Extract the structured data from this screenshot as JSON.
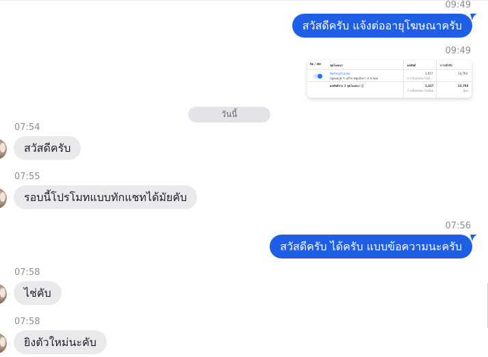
{
  "messages": {
    "m1": {
      "time": "09:49",
      "text": "สวัสดีครับ แจ้งต่ออายุโฆษณาครับ"
    },
    "m2": {
      "time": "09:49"
    },
    "m3": {
      "time": "07:54",
      "text": "สวัสดีครับ"
    },
    "m4": {
      "time": "07:55",
      "text": "รอบนี้โปรโมทแบบทักแชทได้มัยคับ"
    },
    "m5": {
      "time": "07:56",
      "text": "สวัสดีครับ ได้ครับ แบบข้อความนะครับ"
    },
    "m6": {
      "time": "07:58",
      "text": "ไช่คับ"
    },
    "m7": {
      "time": "07:58",
      "text": "ยิงตัวใหม่นะคับ"
    }
  },
  "day_divider": "วันนี้",
  "thumbnail": {
    "col_toggle": "ปิด / เปิด",
    "col_ad_set": "ชุดโฆษณา",
    "col_results": "ผลลัพธ์",
    "col_reach": "การเข้าถึง",
    "ad_name": "ซ้อตัวหรูบ้านลอส",
    "ad_tags": "ปลูกผมกูมิ  ✎ แก้ไข  ⊞ดูแจ้งเร่า  ✐ นำคุณ",
    "results_1": "1,417",
    "results_1_sub": "การเริ่มสนทนาในข้...",
    "reach_1": "13,793",
    "total_label": "ผลลัพธ์จาก 1 ชุดโฆษณา ⓘ",
    "results_2": "1,417",
    "results_2_sub": "การเริ่มสนทนาในข้อค...",
    "reach_2": "13,793",
    "reach_2_sub": "ผู้คน"
  },
  "colors": {
    "outgoing_bubble": "#1e5fe6",
    "incoming_bubble": "#e9eaec"
  }
}
